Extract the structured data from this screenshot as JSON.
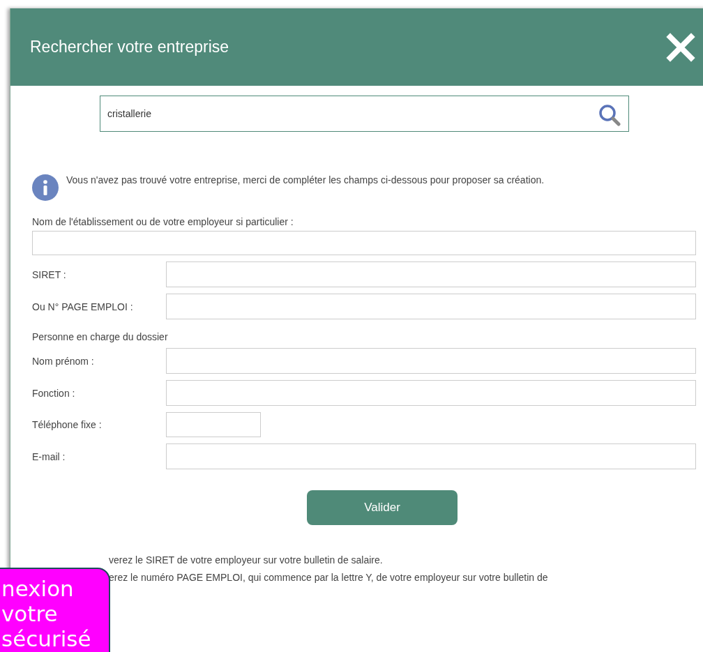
{
  "dialog": {
    "title": "Rechercher votre entreprise"
  },
  "search": {
    "value": "cristallerie"
  },
  "info": {
    "text": "Vous n'avez pas trouvé votre entreprise, merci de compléter les champs ci-dessous pour proposer sa création."
  },
  "form": [
    {
      "kind": "stacked",
      "label": "Nom de l'établissement ou de votre employeur si particulier :"
    },
    {
      "kind": "row",
      "label": "SIRET :"
    },
    {
      "kind": "row",
      "label": "Ou N° PAGE EMPLOI :"
    },
    {
      "kind": "section",
      "label": "Personne en charge du dossier"
    },
    {
      "kind": "row",
      "label": "Nom prénom :"
    },
    {
      "kind": "row",
      "label": "Fonction :"
    },
    {
      "kind": "short",
      "label": "Téléphone fixe :"
    },
    {
      "kind": "row",
      "label": "E-mail :"
    }
  ],
  "submit": {
    "label": "Valider"
  },
  "notes": [
    "verez le SIRET de votre employeur sur votre bulletin de salaire.",
    "erez le numéro PAGE EMPLOI, qui commence par la lettre Y, de votre employeur sur votre bulletin de"
  ],
  "overlay": {
    "lines": [
      "nexion",
      "votre",
      "sécurisé"
    ]
  }
}
